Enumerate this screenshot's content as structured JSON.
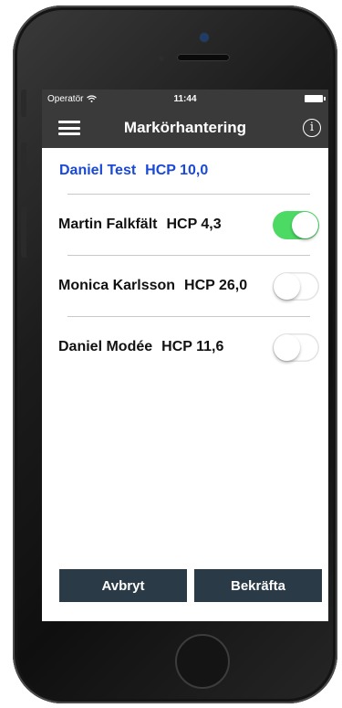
{
  "status_bar": {
    "carrier": "Operatör",
    "time": "11:44"
  },
  "nav": {
    "title": "Markörhantering"
  },
  "owner": {
    "name": "Daniel Test",
    "hcp": "HCP 10,0"
  },
  "markers": [
    {
      "name": "Martin Falkfält",
      "hcp": "HCP 4,3",
      "selected": true
    },
    {
      "name": "Monica Karlsson",
      "hcp": "HCP 26,0",
      "selected": false
    },
    {
      "name": "Daniel Modée",
      "hcp": "HCP 11,6",
      "selected": false
    }
  ],
  "actions": {
    "cancel_label": "Avbryt",
    "confirm_label": "Bekräfta"
  },
  "colors": {
    "accent_blue": "#1a49d6",
    "toggle_on": "#4cd964",
    "nav_bg": "#3a3a3a",
    "button_bg": "#2b3a47"
  }
}
